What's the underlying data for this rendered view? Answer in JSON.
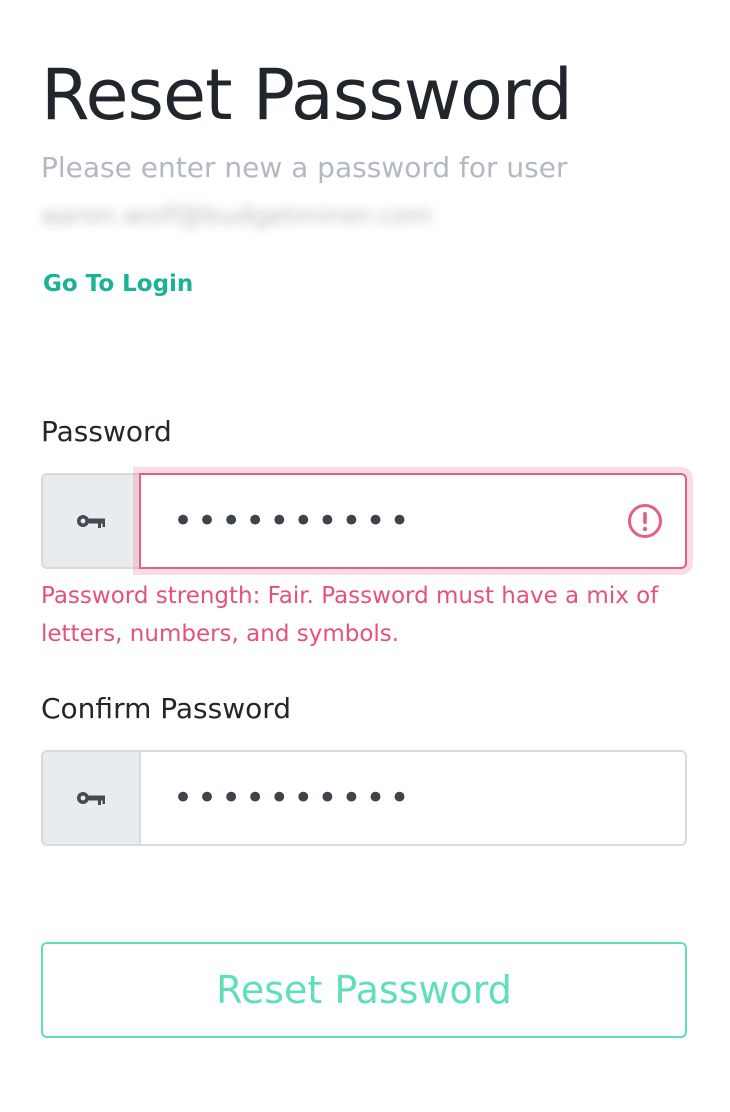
{
  "header": {
    "title": "Reset Password",
    "subtitle": "Please enter new a password for user",
    "email": "aaron.wolf@budgetminer.com",
    "login_link": "Go To Login"
  },
  "form": {
    "password": {
      "label": "Password",
      "value": "••••••••••",
      "icon": "key-icon",
      "status_icon": "alert-circle-icon",
      "error": "Password strength: Fair. Password must have a mix of letters, numbers, and symbols."
    },
    "confirm_password": {
      "label": "Confirm Password",
      "value": "••••••••••",
      "icon": "key-icon"
    },
    "submit_label": "Reset Password"
  },
  "colors": {
    "link": "#1ab394",
    "error": "#e5517a",
    "button_accent": "#5fdfb9",
    "addon_bg": "#e8ecef"
  }
}
